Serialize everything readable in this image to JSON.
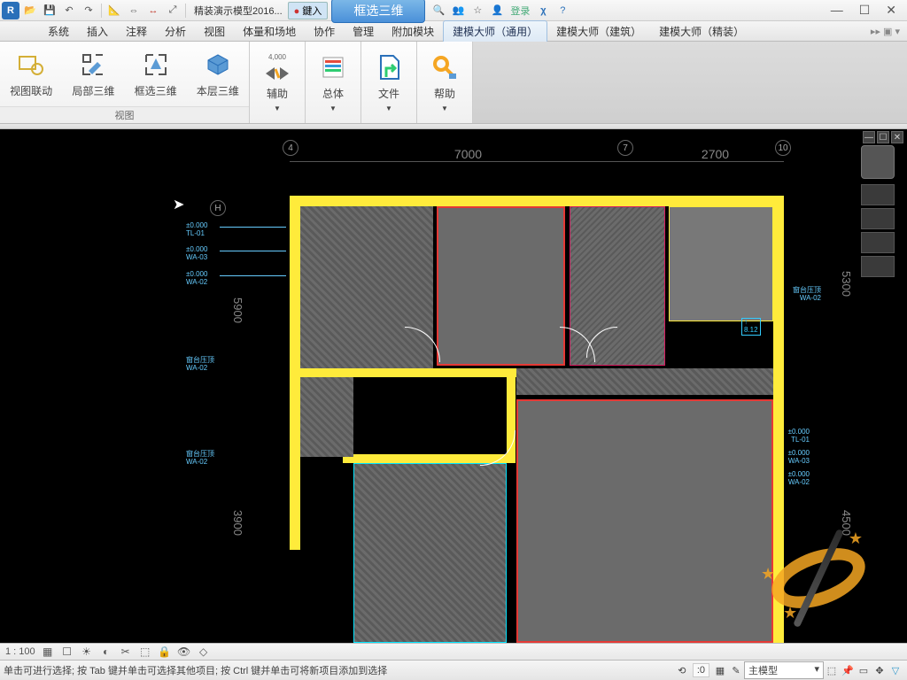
{
  "title": "精装演示模型2016...",
  "search_label": "鍵入",
  "highlight_button": "框选三维",
  "login_label": "登录",
  "menu_tabs": [
    "系统",
    "插入",
    "注释",
    "分析",
    "视图",
    "体量和场地",
    "协作",
    "管理",
    "附加模块",
    "建模大师（通用）",
    "建模大师（建筑）",
    "建模大师（精装）"
  ],
  "active_tab_index": 9,
  "ribbon": {
    "group1_label": "视图",
    "btn1": "视图联动",
    "btn2": "局部三维",
    "btn3": "框选三维",
    "btn4": "本层三维",
    "btn5_top": "4,000",
    "btn5": "辅助",
    "btn6": "总体",
    "btn7": "文件",
    "btn8": "帮助"
  },
  "drawing": {
    "dims_top": [
      "7000",
      "2700"
    ],
    "dim_right": "5300",
    "dim_right2": "4500",
    "dim_left": "5900",
    "dim_left2": "3900",
    "grid_labels": {
      "top1": "4",
      "top2": "7",
      "top3": "10",
      "left1": "H"
    },
    "annotations": {
      "elev_label": "±0.000",
      "tag1": "TL-01",
      "tag2": "WA-02",
      "tag3": "WA-03",
      "room_tag": "窗台压顶",
      "middle_val": "8.12"
    }
  },
  "scalebar": {
    "scale": "1 : 100"
  },
  "statusbar": {
    "message": "单击可进行选择; 按 Tab 键并单击可选择其他项目; 按 Ctrl 键并单击可将新项目添加到选择",
    "slot": ":0",
    "dropdown": "主模型"
  }
}
